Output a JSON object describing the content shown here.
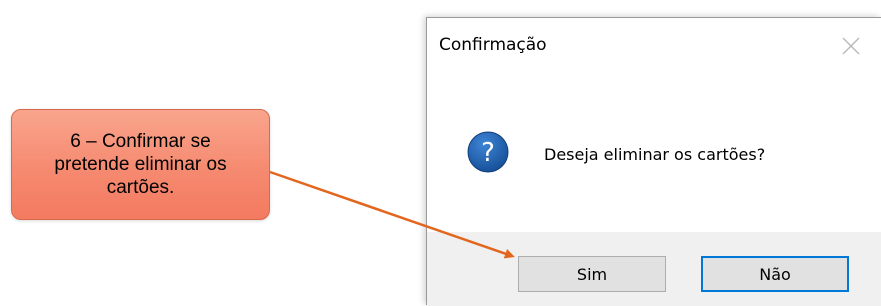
{
  "dialog": {
    "title": "Confirmação",
    "message": "Deseja eliminar os cartões?",
    "icons": {
      "close": "close-icon",
      "message": "question-icon"
    },
    "buttons": {
      "yes_label": "Sim",
      "no_label": "Não"
    }
  },
  "annotation": {
    "callout_text": "6 – Confirmar se pretende eliminar os cartões."
  },
  "colors": {
    "callout_fill": "#f58a70",
    "callout_border": "#d8694a",
    "arrow": "#e3661e",
    "focus_border": "#0078d7",
    "button_area": "#f0f0f0",
    "question_icon": "#1e5ca8"
  }
}
